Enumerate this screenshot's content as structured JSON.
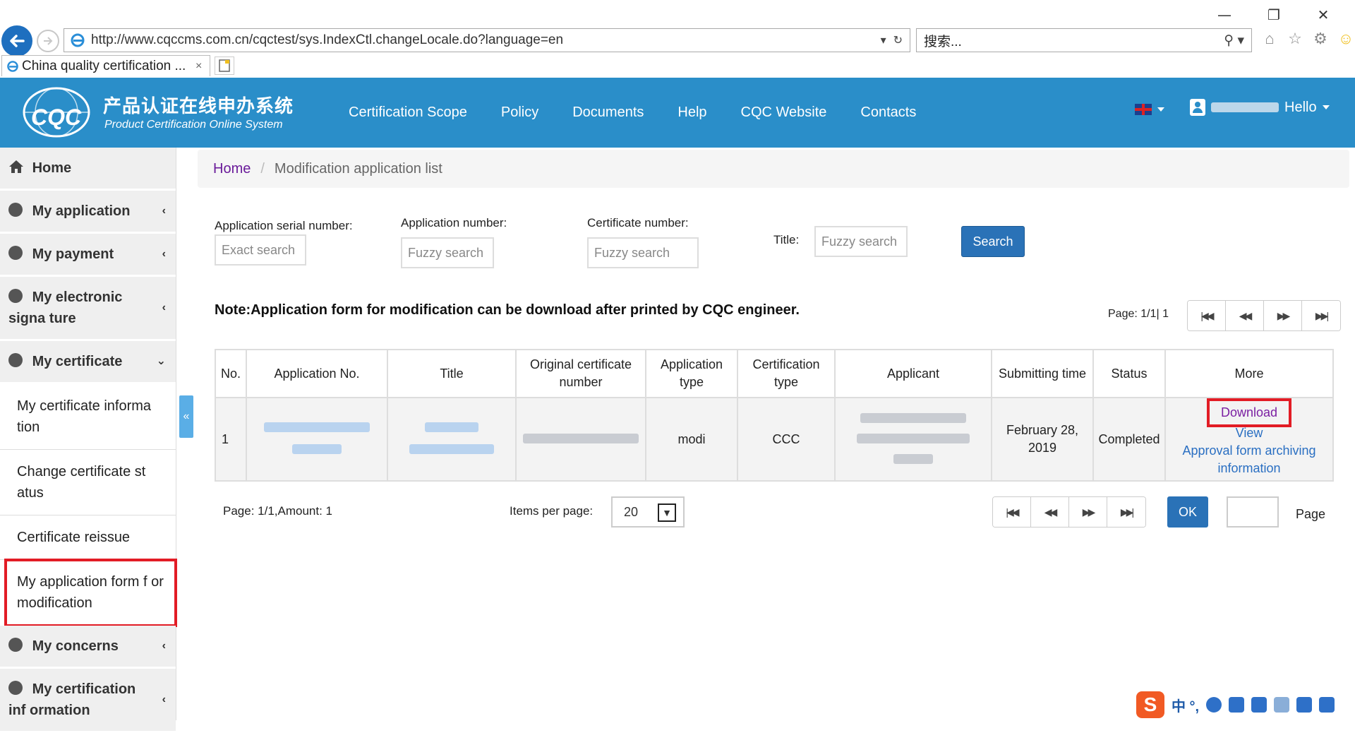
{
  "browser": {
    "url": "http://www.cqccms.com.cn/cqctest/sys.IndexCtl.changeLocale.do?language=en",
    "search_placeholder": "搜索...",
    "tab_title": "China quality certification ...",
    "tab_close": "×",
    "window_controls": [
      "—",
      "❐",
      "✕"
    ]
  },
  "header": {
    "logo_text": "CQC",
    "brand_cn": "产品认证在线申办系统",
    "brand_en": "Product Certification Online System",
    "nav": [
      "Certification Scope",
      "Policy",
      "Documents",
      "Help",
      "CQC Website",
      "Contacts"
    ],
    "greeting": "Hello"
  },
  "sidebar": {
    "home": "Home",
    "my_application": "My application",
    "my_payment": "My payment",
    "my_esign": "My electronic signa ture",
    "my_certificate": "My certificate",
    "sub_items": [
      "My certificate informa tion",
      "Change certificate st atus",
      "Certificate reissue",
      "My application form f or modification"
    ],
    "my_concerns": "My concerns",
    "my_cert_info": "My certification inf ormation"
  },
  "breadcrumb": {
    "home": "Home",
    "separator": "/",
    "current": "Modification application list"
  },
  "filters": {
    "serial_label": "Application serial number:",
    "serial_placeholder": "Exact search",
    "appno_label": "Application number:",
    "appno_placeholder": "Fuzzy search",
    "certno_label": "Certificate number:",
    "certno_placeholder": "Fuzzy search",
    "title_label": "Title:",
    "title_placeholder": "Fuzzy search",
    "search_button": "Search"
  },
  "note": "Note:Application form for modification can be download after printed by CQC engineer.",
  "page_top": "Page: 1/1| 1",
  "table": {
    "headers": [
      "No.",
      "Application No.",
      "Title",
      "Original certificate number",
      "Application type",
      "Certification type",
      "Applicant",
      "Submitting time",
      "Status",
      "More"
    ],
    "row": {
      "no": "1",
      "app_type": "modi",
      "cert_type": "CCC",
      "submit_time": "February 28, 2019",
      "status": "Completed",
      "download": "Download",
      "view": "View",
      "archive": "Approval form archiving information"
    }
  },
  "pagination": {
    "info": "Page: 1/1,Amount: 1",
    "items_per_page_label": "Items per page:",
    "items_per_page": "20",
    "ok": "OK",
    "page_word": "Page"
  },
  "ime": {
    "logo": "S",
    "lang": "中 °,"
  }
}
